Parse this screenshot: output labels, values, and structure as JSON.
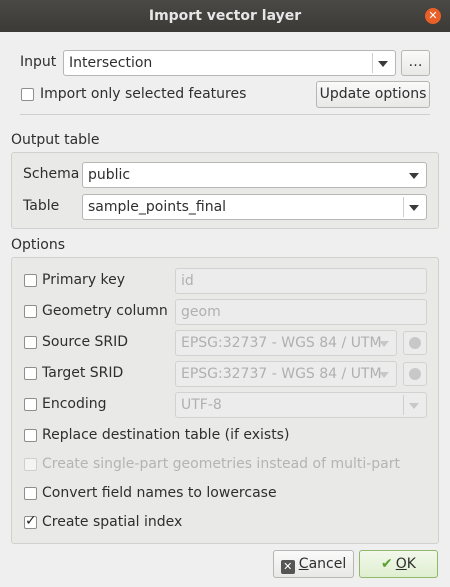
{
  "window": {
    "title": "Import vector layer"
  },
  "input": {
    "label": "Input",
    "value": "Intersection",
    "browse_label": "…"
  },
  "import_selected": {
    "label": "Import only selected features",
    "checked": false
  },
  "update_button": {
    "label": "Update options"
  },
  "output_table": {
    "heading": "Output table",
    "schema_label": "Schema",
    "schema_value": "public",
    "table_label": "Table",
    "table_value": "sample_points_final"
  },
  "options": {
    "heading": "Options",
    "primary_key": {
      "label": "Primary key",
      "value": "id",
      "checked": false
    },
    "geometry_column": {
      "label": "Geometry column",
      "value": "geom",
      "checked": false
    },
    "source_srid": {
      "label": "Source SRID",
      "value": "EPSG:32737 - WGS 84 / UTM",
      "checked": false
    },
    "target_srid": {
      "label": "Target SRID",
      "value": "EPSG:32737 - WGS 84 / UTM",
      "checked": false
    },
    "encoding": {
      "label": "Encoding",
      "value": "UTF-8",
      "checked": false
    },
    "replace_table": {
      "label": "Replace destination table (if exists)",
      "checked": false
    },
    "single_part": {
      "label": "Create single-part geometries instead of multi-part",
      "checked": false,
      "enabled": false
    },
    "lowercase": {
      "label": "Convert field names to lowercase",
      "checked": false
    },
    "spatial_index": {
      "label": "Create spatial index",
      "checked": true
    }
  },
  "buttons": {
    "cancel": "Cancel",
    "ok": "OK",
    "cancel_mnemonic": "C",
    "ok_mnemonic": "O"
  },
  "colors": {
    "titlebar": "#3c3b37",
    "close": "#e95f28",
    "dialog_bg": "#efefef",
    "ok_icon": "#5aa02c",
    "cancel_icon": "#555555"
  }
}
